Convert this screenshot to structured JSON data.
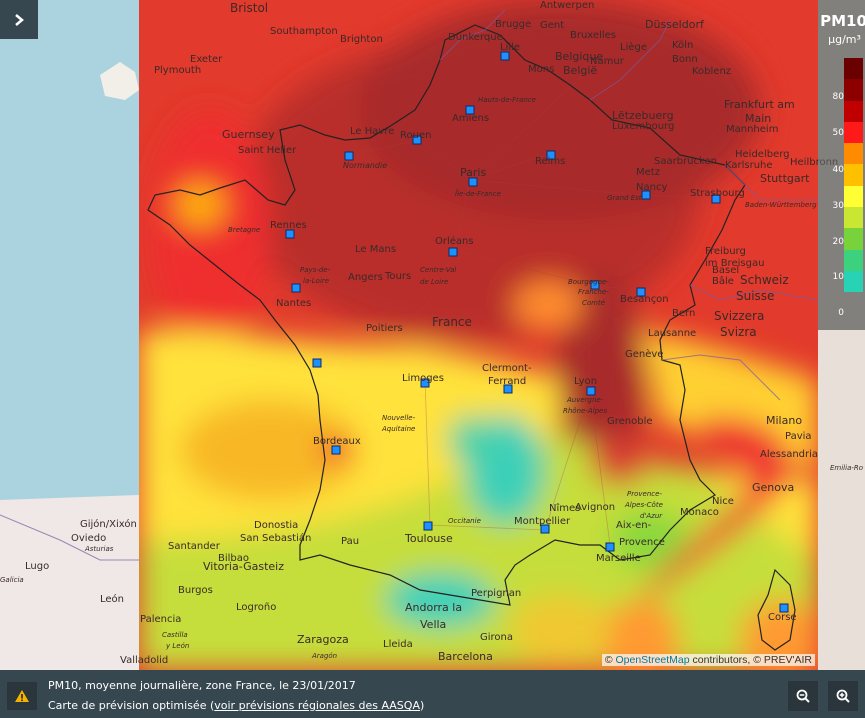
{
  "legend": {
    "title": "PM10",
    "unit": "µg/m³",
    "ticks": [
      "80",
      "50",
      "40",
      "30",
      "20",
      "10",
      "0"
    ],
    "colors": [
      "#6b0000",
      "#8c0000",
      "#c00000",
      "#ff1a1a",
      "#ff8c00",
      "#ffc000",
      "#ffff33",
      "#c8e632",
      "#78d23c",
      "#3cd27d",
      "#28d2b4"
    ]
  },
  "attribution": {
    "prefix": "©",
    "osm_link": "OpenStreetMap",
    "suffix": "contributors, © PREV'AIR"
  },
  "info": {
    "line1": "PM10, moyenne journalière, zone France, le 23/01/2017",
    "line2_prefix": "Carte de prévision optimisée (",
    "line2_link": "voir prévisions régionales des AASQA",
    "line2_suffix": ")"
  },
  "places": {
    "bristol": "Bristol",
    "southampton": "Southampton",
    "brighton": "Brighton",
    "exeter": "Exeter",
    "plymouth": "Plymouth",
    "guernsey": "Guernsey",
    "saint_helier": "Saint Helier",
    "le_havre": "Le Havre",
    "rouen": "Rouen",
    "normandie": "Normandie",
    "amiens": "Amiens",
    "hauts_de_france": "Hauts-de-France",
    "dunkerque": "Dunkerque",
    "lille": "Lille",
    "brugge": "Brugge",
    "antwerpen": "Antwerpen",
    "gent": "Gent",
    "bruxelles": "Bruxelles",
    "belgique": "Belgique",
    "belgien": "België",
    "mons": "Mons",
    "namur": "Namur",
    "liege": "Liège",
    "dusseldorf": "Düsseldorf",
    "koln": "Köln",
    "bonn": "Bonn",
    "koblenz": "Koblenz",
    "luxembourg": "Luxembourg",
    "letzebuerg": "Lëtzebuerg",
    "frankfurt_am": "Frankfurt am",
    "main": "Main",
    "mannheim": "Mannheim",
    "heidelberg": "Heidelberg",
    "saarbrucken": "Saarbrücken",
    "karlsruhe": "Karlsruhe",
    "heilbronn": "Heilbronn",
    "stuttgart": "Stuttgart",
    "reims": "Reims",
    "paris": "Paris",
    "ile_de_france": "Île-de-France",
    "metz": "Metz",
    "nancy": "Nancy",
    "grand_est": "Grand Est",
    "strasbourg": "Strasbourg",
    "baden_wurttemberg": "Baden-Württemberg",
    "rennes": "Rennes",
    "bretagne": "Bretagne",
    "le_mans": "Le Mans",
    "orleans": "Orléans",
    "freiburg": "Freiburg",
    "im_breisgau": "im Breisgau",
    "basel": "Basel",
    "bale": "Bâle",
    "schweiz": "Schweiz",
    "suisse": "Suisse",
    "angers": "Angers",
    "tours": "Tours",
    "centre_val": "Centre-Val",
    "de_loire": "de Loire",
    "pays_de": "Pays-de-",
    "la_loire": "la-Loire",
    "nantes": "Nantes",
    "bourgogne": "Bourgogne-",
    "franche": "Franche-",
    "comte": "Comté",
    "besancon": "Besançon",
    "bern": "Bern",
    "svizzera": "Svizzera",
    "svizra": "Svizra",
    "lausanne": "Lausanne",
    "geneve": "Genève",
    "poitiers": "Poitiers",
    "france": "France",
    "limoges": "Limoges",
    "clermont": "Clermont-",
    "ferrand": "Ferrand",
    "lyon": "Lyon",
    "auvergne": "Auvergne-",
    "rhone_alpes": "Rhône-Alpes",
    "grenoble": "Grenoble",
    "nouvelle": "Nouvelle-",
    "aquitaine": "Aquitaine",
    "bordeaux": "Bordeaux",
    "milano": "Milano",
    "pavia": "Pavia",
    "alessandria": "Alessandria",
    "genova": "Genova",
    "emilia_rom": "Emilia-Ro",
    "occitanie": "Occitanie",
    "toulouse": "Toulouse",
    "nimes": "Nîmes",
    "avignon": "Avignon",
    "montpellier": "Montpellier",
    "provence_alpes": "Provence-",
    "cote_dazur": "Alpes-Côte",
    "dazur": "d'Azur",
    "aix": "Aix-en-",
    "aix2": "Provence",
    "marseille": "Marseille",
    "nice": "Nice",
    "monaco": "Monaco",
    "gijon": "Gijón/Xixón",
    "oviedo": "Oviedo",
    "asturias": "Asturias",
    "lugo": "Lugo",
    "santander": "Santander",
    "donostia": "Donostia",
    "san_sebastian": "San Sebastián",
    "bilbao": "Bilbao",
    "vitoria": "Vitoria-Gasteiz",
    "pau": "Pau",
    "leon": "León",
    "burgos": "Burgos",
    "logrono": "Logroño",
    "palencia": "Palencia",
    "castilla": "Castilla",
    "y_leon": "y León",
    "valladolid": "Valladolid",
    "zaragoza": "Zaragoza",
    "aragon": "Aragón",
    "lleida": "Lleida",
    "andorra": "Andorra la",
    "vella": "Vella",
    "girona": "Girona",
    "perpignan": "Perpignan",
    "barcelona": "Barcelona",
    "corse": "Corse",
    "galicia": "Galicia",
    "la": "la"
  }
}
